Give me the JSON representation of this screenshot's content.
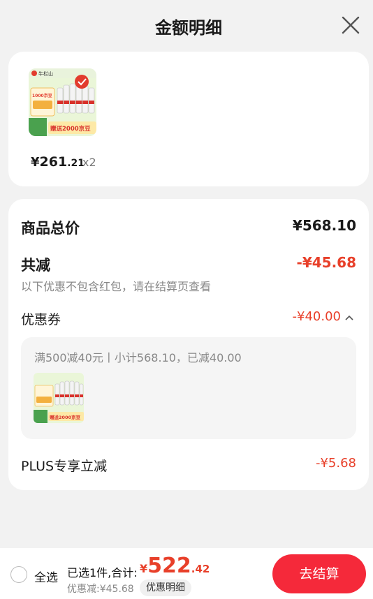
{
  "header": {
    "title": "金额明细"
  },
  "product": {
    "price_yen": "¥",
    "price_int": "261",
    "price_dec": ".21",
    "quantity": "x2",
    "image_label": "赠送2000京豆",
    "image_badge": "1000京豆",
    "image_top": "牛栏山"
  },
  "summary": {
    "goods_total_label": "商品总价",
    "goods_total_value": "¥568.10",
    "reduction_label": "共减",
    "reduction_value": "-¥45.68",
    "reduction_note": "以下优惠不包含红包，请在结算页查看",
    "coupon_label": "优惠券",
    "coupon_value": "-¥40.00",
    "coupon_detail": "满500减40元丨小计568.10，已减40.00",
    "plus_label": "PLUS专享立减",
    "plus_value": "-¥5.68"
  },
  "bottom": {
    "select_all": "全选",
    "selected_text": "已选1件,合计:",
    "total_yen": "¥",
    "total_int": "522",
    "total_dec": ".42",
    "discount_text": "优惠减:¥45.68",
    "detail_button": "优惠明细",
    "checkout_button": "去结算"
  },
  "colors": {
    "accent_red": "#e8402a",
    "checkout_red": "#f5293a",
    "background": "#f2f2f2"
  },
  "icons": {
    "close": "close-icon",
    "collapse": "chevron-up-icon",
    "radio": "radio-unchecked-icon"
  }
}
